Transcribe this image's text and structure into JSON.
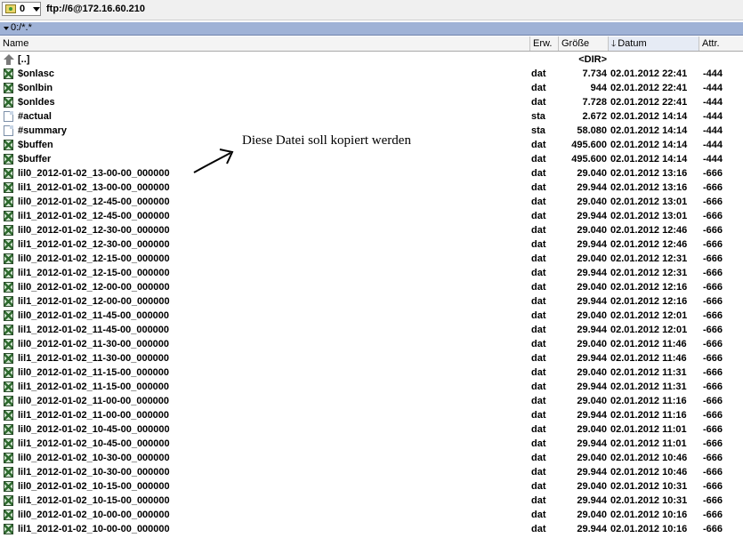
{
  "toolbar": {
    "drive_label": "0",
    "path": "ftp://6@172.16.60.210"
  },
  "pathbar": {
    "text": "0:/*.*"
  },
  "columns": {
    "name": "Name",
    "ext": "Erw.",
    "size": "Größe",
    "date": "Datum",
    "attr": "Attr."
  },
  "annotation": {
    "text": "Diese Datei soll kopiert werden"
  },
  "rows": [
    {
      "icon": "up-folder-icon",
      "name": "[..]",
      "ext": "",
      "size": "<DIR>",
      "date": "",
      "attr": ""
    },
    {
      "icon": "binary-file-icon",
      "name": "$onlasc",
      "ext": "dat",
      "size": "7.734",
      "date": "02.01.2012 22:41",
      "attr": "-444"
    },
    {
      "icon": "binary-file-icon",
      "name": "$onlbin",
      "ext": "dat",
      "size": "944",
      "date": "02.01.2012 22:41",
      "attr": "-444"
    },
    {
      "icon": "binary-file-icon",
      "name": "$onldes",
      "ext": "dat",
      "size": "7.728",
      "date": "02.01.2012 22:41",
      "attr": "-444"
    },
    {
      "icon": "document-icon",
      "name": "#actual",
      "ext": "sta",
      "size": "2.672",
      "date": "02.01.2012 14:14",
      "attr": "-444"
    },
    {
      "icon": "document-icon",
      "name": "#summary",
      "ext": "sta",
      "size": "58.080",
      "date": "02.01.2012 14:14",
      "attr": "-444"
    },
    {
      "icon": "binary-file-icon",
      "name": "$buffen",
      "ext": "dat",
      "size": "495.600",
      "date": "02.01.2012 14:14",
      "attr": "-444"
    },
    {
      "icon": "binary-file-icon",
      "name": "$buffer",
      "ext": "dat",
      "size": "495.600",
      "date": "02.01.2012 14:14",
      "attr": "-444"
    },
    {
      "icon": "binary-file-icon",
      "name": "lil0_2012-01-02_13-00-00_000000",
      "ext": "dat",
      "size": "29.040",
      "date": "02.01.2012 13:16",
      "attr": "-666"
    },
    {
      "icon": "binary-file-icon",
      "name": "lil1_2012-01-02_13-00-00_000000",
      "ext": "dat",
      "size": "29.944",
      "date": "02.01.2012 13:16",
      "attr": "-666"
    },
    {
      "icon": "binary-file-icon",
      "name": "lil0_2012-01-02_12-45-00_000000",
      "ext": "dat",
      "size": "29.040",
      "date": "02.01.2012 13:01",
      "attr": "-666"
    },
    {
      "icon": "binary-file-icon",
      "name": "lil1_2012-01-02_12-45-00_000000",
      "ext": "dat",
      "size": "29.944",
      "date": "02.01.2012 13:01",
      "attr": "-666"
    },
    {
      "icon": "binary-file-icon",
      "name": "lil0_2012-01-02_12-30-00_000000",
      "ext": "dat",
      "size": "29.040",
      "date": "02.01.2012 12:46",
      "attr": "-666"
    },
    {
      "icon": "binary-file-icon",
      "name": "lil1_2012-01-02_12-30-00_000000",
      "ext": "dat",
      "size": "29.944",
      "date": "02.01.2012 12:46",
      "attr": "-666"
    },
    {
      "icon": "binary-file-icon",
      "name": "lil0_2012-01-02_12-15-00_000000",
      "ext": "dat",
      "size": "29.040",
      "date": "02.01.2012 12:31",
      "attr": "-666"
    },
    {
      "icon": "binary-file-icon",
      "name": "lil1_2012-01-02_12-15-00_000000",
      "ext": "dat",
      "size": "29.944",
      "date": "02.01.2012 12:31",
      "attr": "-666"
    },
    {
      "icon": "binary-file-icon",
      "name": "lil0_2012-01-02_12-00-00_000000",
      "ext": "dat",
      "size": "29.040",
      "date": "02.01.2012 12:16",
      "attr": "-666"
    },
    {
      "icon": "binary-file-icon",
      "name": "lil1_2012-01-02_12-00-00_000000",
      "ext": "dat",
      "size": "29.944",
      "date": "02.01.2012 12:16",
      "attr": "-666"
    },
    {
      "icon": "binary-file-icon",
      "name": "lil0_2012-01-02_11-45-00_000000",
      "ext": "dat",
      "size": "29.040",
      "date": "02.01.2012 12:01",
      "attr": "-666"
    },
    {
      "icon": "binary-file-icon",
      "name": "lil1_2012-01-02_11-45-00_000000",
      "ext": "dat",
      "size": "29.944",
      "date": "02.01.2012 12:01",
      "attr": "-666"
    },
    {
      "icon": "binary-file-icon",
      "name": "lil0_2012-01-02_11-30-00_000000",
      "ext": "dat",
      "size": "29.040",
      "date": "02.01.2012 11:46",
      "attr": "-666"
    },
    {
      "icon": "binary-file-icon",
      "name": "lil1_2012-01-02_11-30-00_000000",
      "ext": "dat",
      "size": "29.944",
      "date": "02.01.2012 11:46",
      "attr": "-666"
    },
    {
      "icon": "binary-file-icon",
      "name": "lil0_2012-01-02_11-15-00_000000",
      "ext": "dat",
      "size": "29.040",
      "date": "02.01.2012 11:31",
      "attr": "-666"
    },
    {
      "icon": "binary-file-icon",
      "name": "lil1_2012-01-02_11-15-00_000000",
      "ext": "dat",
      "size": "29.944",
      "date": "02.01.2012 11:31",
      "attr": "-666"
    },
    {
      "icon": "binary-file-icon",
      "name": "lil0_2012-01-02_11-00-00_000000",
      "ext": "dat",
      "size": "29.040",
      "date": "02.01.2012 11:16",
      "attr": "-666"
    },
    {
      "icon": "binary-file-icon",
      "name": "lil1_2012-01-02_11-00-00_000000",
      "ext": "dat",
      "size": "29.944",
      "date": "02.01.2012 11:16",
      "attr": "-666"
    },
    {
      "icon": "binary-file-icon",
      "name": "lil0_2012-01-02_10-45-00_000000",
      "ext": "dat",
      "size": "29.040",
      "date": "02.01.2012 11:01",
      "attr": "-666"
    },
    {
      "icon": "binary-file-icon",
      "name": "lil1_2012-01-02_10-45-00_000000",
      "ext": "dat",
      "size": "29.944",
      "date": "02.01.2012 11:01",
      "attr": "-666"
    },
    {
      "icon": "binary-file-icon",
      "name": "lil0_2012-01-02_10-30-00_000000",
      "ext": "dat",
      "size": "29.040",
      "date": "02.01.2012 10:46",
      "attr": "-666"
    },
    {
      "icon": "binary-file-icon",
      "name": "lil1_2012-01-02_10-30-00_000000",
      "ext": "dat",
      "size": "29.944",
      "date": "02.01.2012 10:46",
      "attr": "-666"
    },
    {
      "icon": "binary-file-icon",
      "name": "lil0_2012-01-02_10-15-00_000000",
      "ext": "dat",
      "size": "29.040",
      "date": "02.01.2012 10:31",
      "attr": "-666"
    },
    {
      "icon": "binary-file-icon",
      "name": "lil1_2012-01-02_10-15-00_000000",
      "ext": "dat",
      "size": "29.944",
      "date": "02.01.2012 10:31",
      "attr": "-666"
    },
    {
      "icon": "binary-file-icon",
      "name": "lil0_2012-01-02_10-00-00_000000",
      "ext": "dat",
      "size": "29.040",
      "date": "02.01.2012 10:16",
      "attr": "-666"
    },
    {
      "icon": "binary-file-icon",
      "name": "lil1_2012-01-02_10-00-00_000000",
      "ext": "dat",
      "size": "29.944",
      "date": "02.01.2012 10:16",
      "attr": "-666"
    }
  ]
}
